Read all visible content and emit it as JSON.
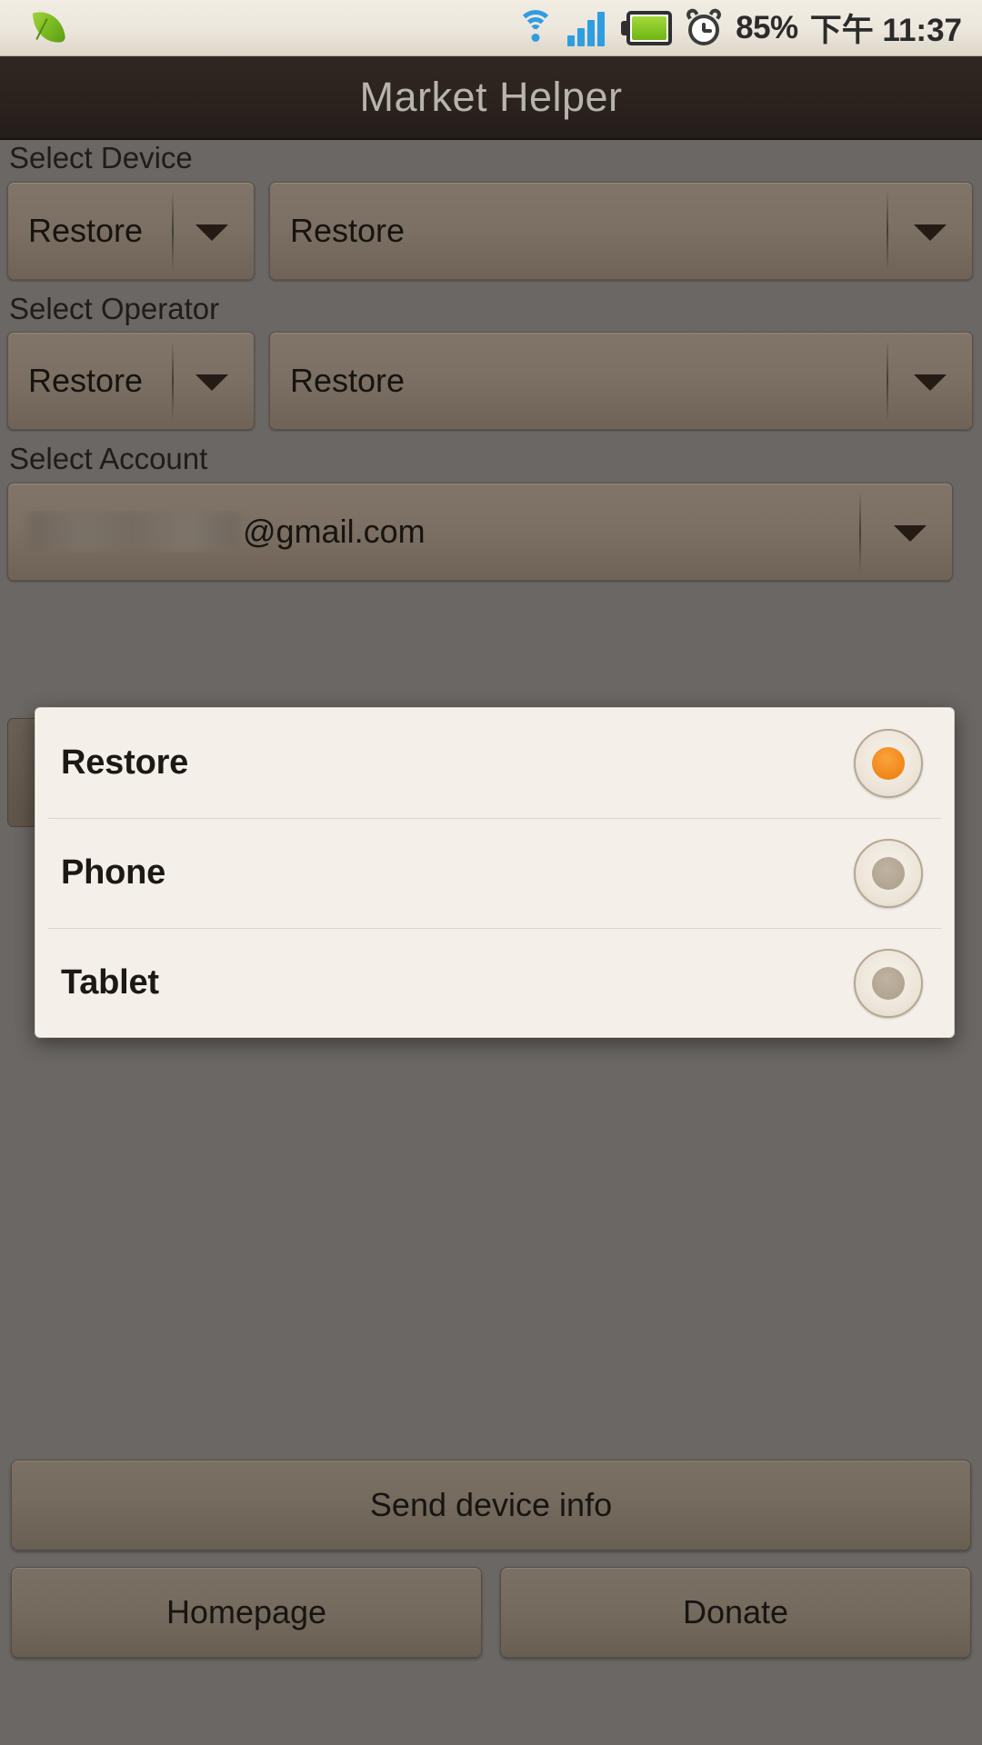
{
  "status_bar": {
    "leaf_icon": "leaf-icon",
    "wifi_icon": "wifi-icon",
    "signal_icon": "signal-bars-icon",
    "battery_icon": "battery-icon",
    "alarm_icon": "alarm-clock-icon",
    "battery_percent": "85%",
    "time": "下午 11:37"
  },
  "title_bar": {
    "title": "Market Helper"
  },
  "form": {
    "device": {
      "label": "Select Device",
      "left_value": "Restore",
      "right_value": "Restore"
    },
    "operator": {
      "label": "Select Operator",
      "left_value": "Restore",
      "right_value": "Restore"
    },
    "account": {
      "label": "Select Account",
      "value": "@gmail.com"
    }
  },
  "dialog": {
    "options": [
      {
        "label": "Restore",
        "selected": true
      },
      {
        "label": "Phone",
        "selected": false
      },
      {
        "label": "Tablet",
        "selected": false
      }
    ]
  },
  "actions": {
    "send_device_info": "Send device info",
    "homepage": "Homepage",
    "donate": "Donate"
  },
  "colors": {
    "background": "#6a6764",
    "title_bar": "#2a221d",
    "spinner": "#7b7063",
    "dialog_bg": "#f4efe8",
    "accent_selected": "#f28a1e",
    "radio_unselected": "#ab9e8b"
  }
}
